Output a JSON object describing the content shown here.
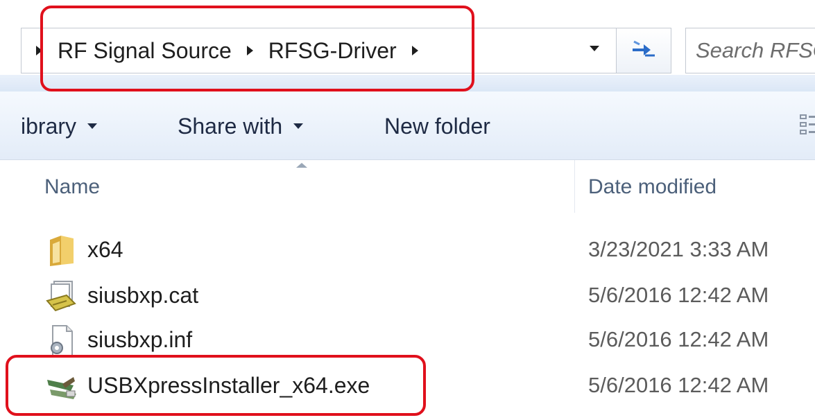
{
  "address_bar": {
    "breadcrumbs": [
      "RF Signal Source",
      "RFSG-Driver"
    ]
  },
  "search": {
    "placeholder": "Search RFSG-Driver"
  },
  "toolbar": {
    "library_label": "ibrary",
    "share_label": "Share with",
    "new_folder_label": "New folder"
  },
  "columns": {
    "name": "Name",
    "date_modified": "Date modified"
  },
  "files": [
    {
      "name": "x64",
      "date": "3/23/2021 3:33 AM",
      "icon": "folder-icon"
    },
    {
      "name": "siusbxp.cat",
      "date": "5/6/2016 12:42 AM",
      "icon": "security-catalog-icon"
    },
    {
      "name": "siusbxp.inf",
      "date": "5/6/2016 12:42 AM",
      "icon": "setup-info-file-icon"
    },
    {
      "name": "USBXpressInstaller_x64.exe",
      "date": "5/6/2016 12:42 AM",
      "icon": "installer-exe-icon"
    }
  ],
  "colors": {
    "highlight": "#e0101c",
    "toolbar_bg": "#e3ecf8",
    "header_text": "#4c607a"
  }
}
